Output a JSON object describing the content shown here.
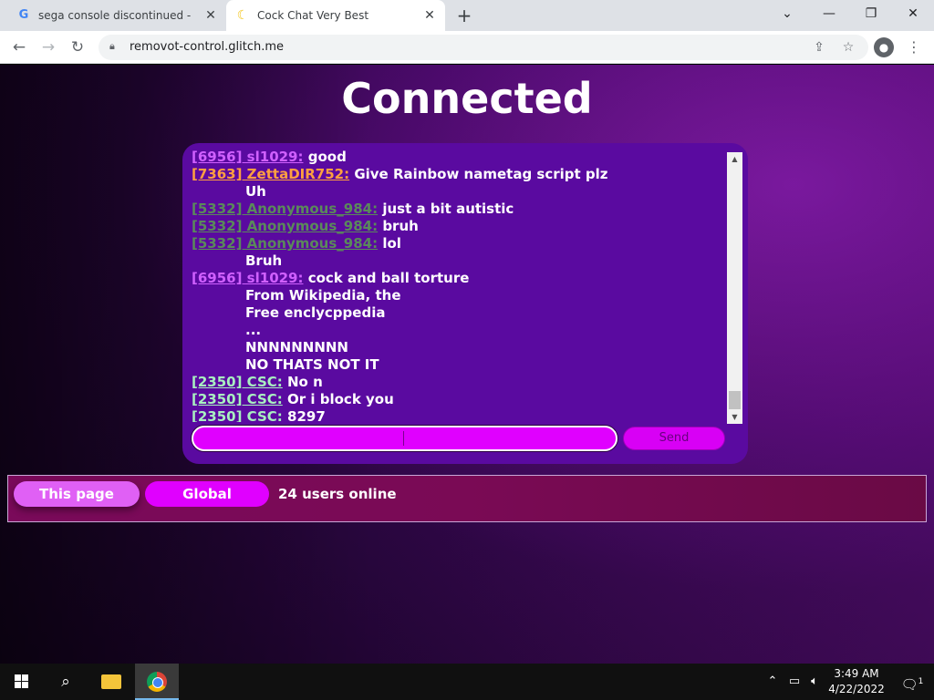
{
  "browser": {
    "tabs": [
      {
        "title": "sega console discontinued - Goo",
        "favicon": "google-icon",
        "active": false
      },
      {
        "title": "Cock Chat Very Best",
        "favicon": "moon-icon",
        "active": true
      }
    ],
    "new_tab_glyph": "+",
    "url": "removot-control.glitch.me"
  },
  "page": {
    "title": "Connected"
  },
  "chat": {
    "messages": [
      {
        "tag": "[6956] sl1029:",
        "text": " good",
        "color": "#d060ff",
        "cont": false
      },
      {
        "tag": "[7363] ZettaDIR752:",
        "text": " Give Rainbow nametag script plz",
        "color": "#ffa040",
        "cont": false
      },
      {
        "tag": "",
        "text": "Uh",
        "color": "#ffffff",
        "cont": true
      },
      {
        "tag": "[5332] Anonymous_984:",
        "text": " just a bit autistic",
        "color": "#5a8a5a",
        "cont": false
      },
      {
        "tag": "[5332] Anonymous_984:",
        "text": " bruh",
        "color": "#5a8a5a",
        "cont": false
      },
      {
        "tag": "[5332] Anonymous_984:",
        "text": " lol",
        "color": "#5a8a5a",
        "cont": false
      },
      {
        "tag": "",
        "text": "Bruh",
        "color": "#ffffff",
        "cont": true
      },
      {
        "tag": "[6956] sl1029:",
        "text": " cock and ball torture",
        "color": "#d060ff",
        "cont": false
      },
      {
        "tag": "",
        "text": "From Wikipedia, the",
        "color": "#ffffff",
        "cont": true
      },
      {
        "tag": "",
        "text": "Free enclycppedia",
        "color": "#ffffff",
        "cont": true
      },
      {
        "tag": "",
        "text": "...",
        "color": "#ffffff",
        "cont": true
      },
      {
        "tag": "",
        "text": "NNNNNNNNN",
        "color": "#ffffff",
        "cont": true
      },
      {
        "tag": "",
        "text": "NO THATS NOT IT",
        "color": "#ffffff",
        "cont": true
      },
      {
        "tag": "[2350] CSC:",
        "text": " No n",
        "color": "#a8f0c0",
        "cont": false
      },
      {
        "tag": "[2350] CSC:",
        "text": " Or i block you",
        "color": "#a8f0c0",
        "cont": false
      },
      {
        "tag": "[2350] CSC:",
        "text": " 8297",
        "color": "#a8f0c0",
        "cont": false
      }
    ],
    "input_value": "",
    "send_label": "Send"
  },
  "online": {
    "this_page_label": "This page",
    "global_label": "Global",
    "count_text": "24 users online"
  },
  "taskbar": {
    "time": "3:49 AM",
    "date": "4/22/2022",
    "notification_count": "1"
  }
}
